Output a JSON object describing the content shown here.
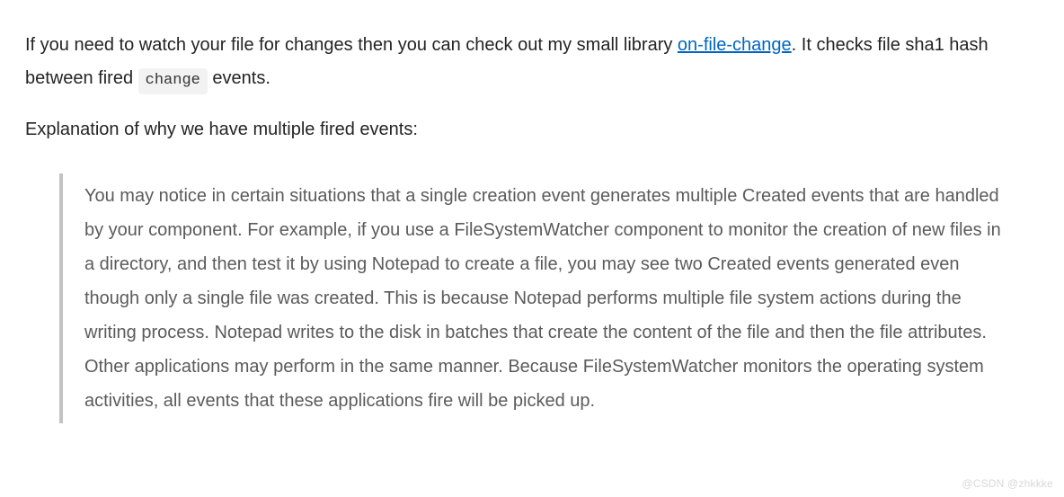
{
  "intro": {
    "before_link": "If you need to watch your file for changes then you can check out my small library ",
    "link_text": "on-file-change",
    "after_link_before_code": ". It checks file sha1 hash between fired ",
    "code_text": "change",
    "after_code": " events."
  },
  "explanation_intro": "Explanation of why we have multiple fired events:",
  "blockquote": "You may notice in certain situations that a single creation event generates multiple Created events that are handled by your component. For example, if you use a FileSystemWatcher component to monitor the creation of new files in a directory, and then test it by using Notepad to create a file, you may see two Created events generated even though only a single file was created. This is because Notepad performs multiple file system actions during the writing process. Notepad writes to the disk in batches that create the content of the file and then the file attributes. Other applications may perform in the same manner. Because FileSystemWatcher monitors the operating system activities, all events that these applications fire will be picked up.",
  "watermark": "@CSDN @zhkkke"
}
